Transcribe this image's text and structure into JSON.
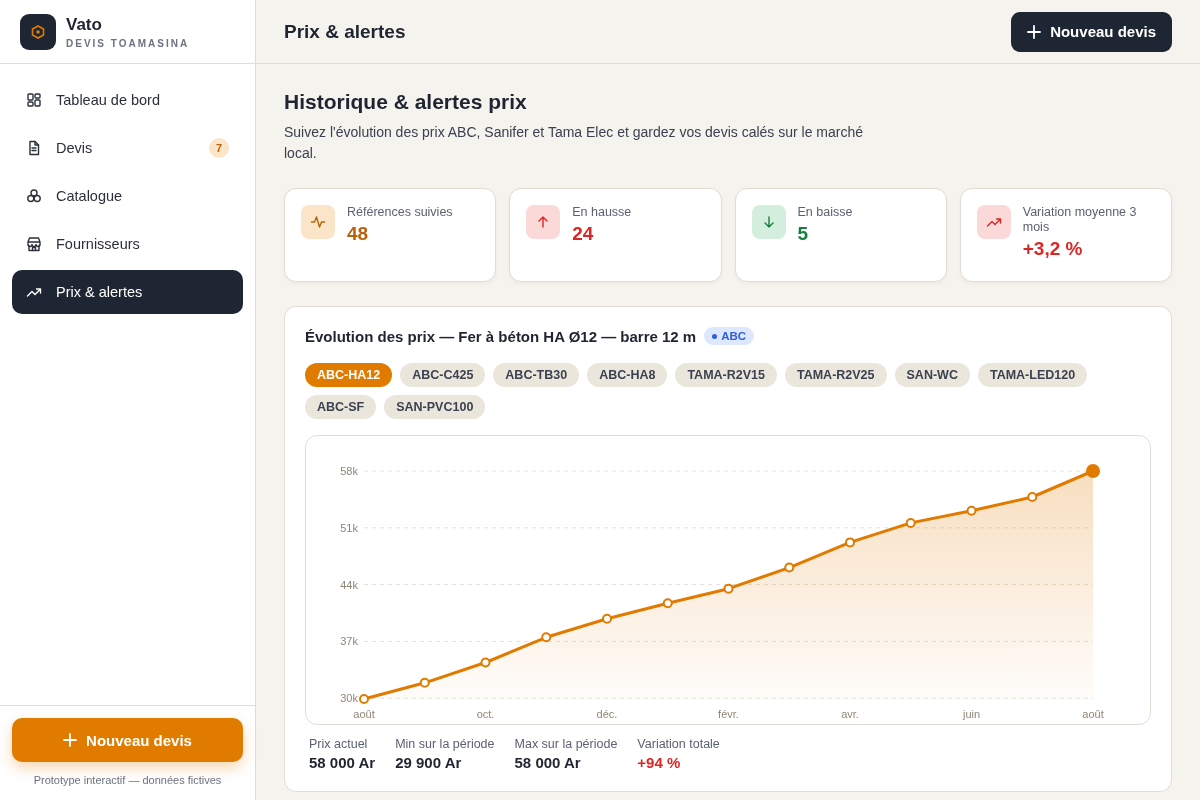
{
  "brand": {
    "name": "Vato",
    "subtitle": "DEVIS TOAMASINA"
  },
  "sidebar": {
    "items": [
      {
        "label": "Tableau de bord",
        "selected": false
      },
      {
        "label": "Devis",
        "selected": false,
        "badge": "7"
      },
      {
        "label": "Catalogue",
        "selected": false
      },
      {
        "label": "Fournisseurs",
        "selected": false
      },
      {
        "label": "Prix & alertes",
        "selected": true
      }
    ],
    "new_button": "Nouveau devis",
    "footer": "Prototype interactif — données fictives"
  },
  "header": {
    "title": "Prix & alertes",
    "new_button": "Nouveau devis"
  },
  "page": {
    "title": "Historique & alertes prix",
    "description": "Suivez l'évolution des prix ABC, Sanifer et Tama Elec et gardez vos devis calés sur le marché local."
  },
  "stats": [
    {
      "label": "Références suivies",
      "value": "48",
      "kind": "pulse"
    },
    {
      "label": "En hausse",
      "value": "24",
      "kind": "up"
    },
    {
      "label": "En baisse",
      "value": "5",
      "kind": "down"
    },
    {
      "label": "Variation moyenne 3 mois",
      "value": "+3,2 %",
      "kind": "trend"
    }
  ],
  "chart_panel": {
    "title": "Évolution des prix — Fer à béton HA Ø12 — barre 12 m",
    "supplier_tag": "ABC",
    "references": [
      {
        "label": "ABC-HA12",
        "selected": true
      },
      {
        "label": "ABC-C425",
        "selected": false
      },
      {
        "label": "ABC-TB30",
        "selected": false
      },
      {
        "label": "ABC-HA8",
        "selected": false
      },
      {
        "label": "TAMA-R2V15",
        "selected": false
      },
      {
        "label": "TAMA-R2V25",
        "selected": false
      },
      {
        "label": "SAN-WC",
        "selected": false
      },
      {
        "label": "TAMA-LED120",
        "selected": false
      },
      {
        "label": "ABC-SF",
        "selected": false
      },
      {
        "label": "SAN-PVC100",
        "selected": false
      }
    ],
    "chart_data": {
      "type": "area",
      "categories": [
        "août",
        null,
        "oct.",
        null,
        "déc.",
        null,
        "févr.",
        null,
        "avr.",
        null,
        "juin",
        null,
        "août"
      ],
      "series": [
        {
          "color": "#e07b00",
          "values": [
            29900,
            31900,
            34400,
            37500,
            39800,
            41700,
            43500,
            46100,
            49200,
            51600,
            53100,
            54800,
            58000
          ]
        }
      ],
      "ylim": [
        29900,
        58000
      ],
      "grid": true,
      "yticks": [
        {
          "value": 30000,
          "label": "30k"
        },
        {
          "value": 37000,
          "label": "37k"
        },
        {
          "value": 44000,
          "label": "44k"
        },
        {
          "value": 51000,
          "label": "51k"
        },
        {
          "value": 58000,
          "label": "58k"
        }
      ]
    },
    "summary": [
      {
        "label": "Prix actuel",
        "value": "58 000 Ar",
        "kind": "plain"
      },
      {
        "label": "Min sur la période",
        "value": "29 900 Ar",
        "kind": "plain"
      },
      {
        "label": "Max sur la période",
        "value": "58 000 Ar",
        "kind": "plain"
      },
      {
        "label": "Variation totale",
        "value": "+94 %",
        "kind": "up"
      }
    ]
  }
}
